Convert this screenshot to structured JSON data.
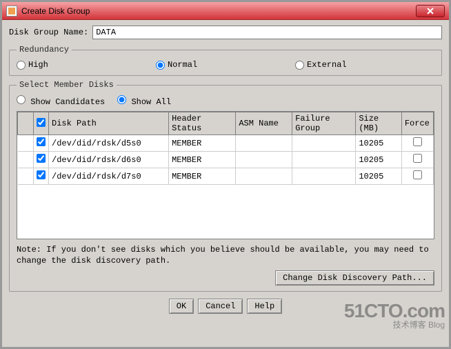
{
  "window": {
    "title": "Create Disk Group"
  },
  "nameField": {
    "label": "Disk Group Name:",
    "value": "DATA"
  },
  "redundancy": {
    "legend": "Redundancy",
    "options": {
      "high": "High",
      "normal": "Normal",
      "external": "External"
    },
    "selected": "normal"
  },
  "memberDisks": {
    "legend": "Select Member Disks",
    "filter": {
      "candidates": "Show Candidates",
      "all": "Show All",
      "selected": "all"
    },
    "columns": {
      "diskPath": "Disk Path",
      "headerStatus": "Header Status",
      "asmName": "ASM Name",
      "failureGroup": "Failure Group",
      "sizeMB": "Size (MB)",
      "force": "Force"
    },
    "rows": [
      {
        "checked": true,
        "diskPath": "/dev/did/rdsk/d5s0",
        "headerStatus": "MEMBER",
        "asmName": "",
        "failureGroup": "",
        "sizeMB": "10205",
        "force": false
      },
      {
        "checked": true,
        "diskPath": "/dev/did/rdsk/d6s0",
        "headerStatus": "MEMBER",
        "asmName": "",
        "failureGroup": "",
        "sizeMB": "10205",
        "force": false
      },
      {
        "checked": true,
        "diskPath": "/dev/did/rdsk/d7s0",
        "headerStatus": "MEMBER",
        "asmName": "",
        "failureGroup": "",
        "sizeMB": "10205",
        "force": false
      }
    ],
    "note": "Note: If you don't see disks which you believe should be available, you may need to change the disk discovery path.",
    "changePathButton": "Change Disk Discovery Path..."
  },
  "buttons": {
    "ok": "OK",
    "cancel": "Cancel",
    "help": "Help"
  },
  "watermark": {
    "big": "51CTO.com",
    "small": "技术博客    Blog"
  }
}
